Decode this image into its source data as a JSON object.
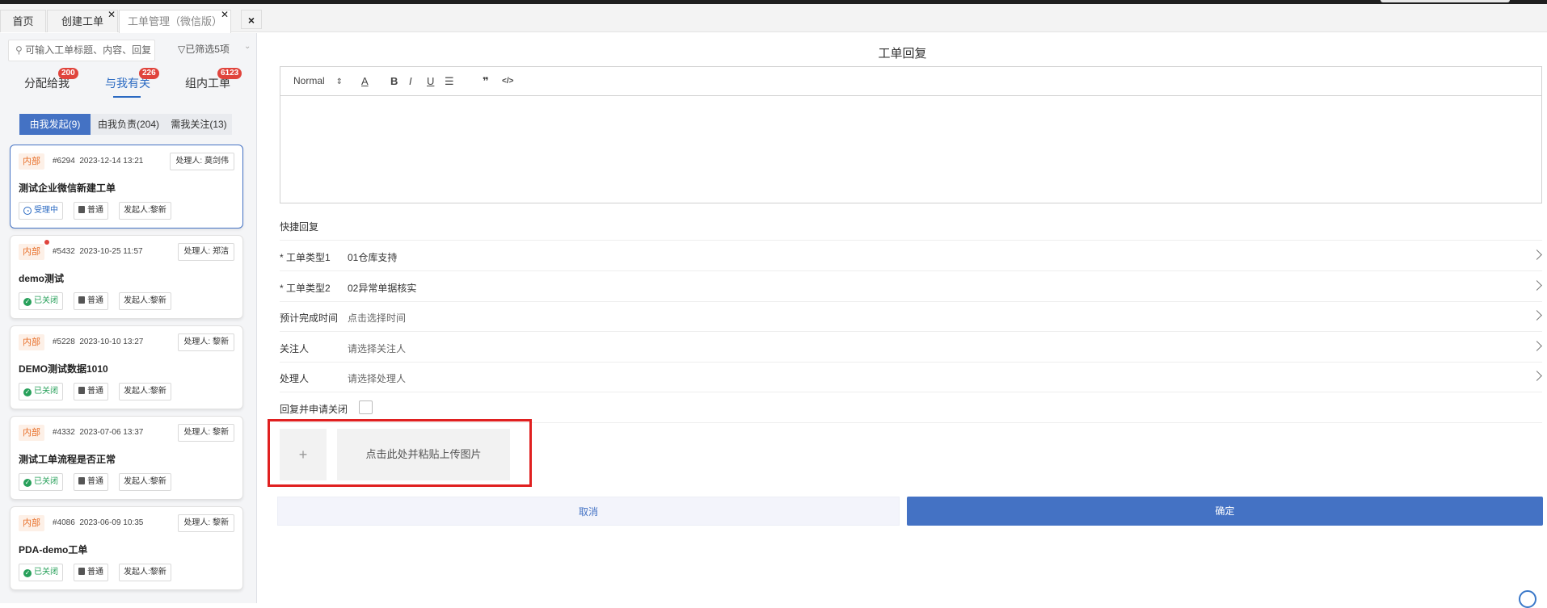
{
  "tabs": [
    {
      "label": "首页",
      "closable": false
    },
    {
      "label": "创建工单",
      "closable": true
    },
    {
      "label": "工单管理（微信版）",
      "closable": true,
      "active": true
    }
  ],
  "close_all_label": "×",
  "sidebar": {
    "search_placeholder": "可输入工单标题、内容、回复",
    "filter_label": "已筛选5项",
    "categories": [
      {
        "label": "分配给我",
        "badge": "200"
      },
      {
        "label": "与我有关",
        "badge": "226",
        "active": true
      },
      {
        "label": "组内工单",
        "badge": "6123"
      }
    ],
    "subtabs": [
      {
        "label": "由我发起(9)",
        "active": true
      },
      {
        "label": "由我负责(204)"
      },
      {
        "label": "需我关注(13)"
      }
    ],
    "cards": [
      {
        "tag": "内部",
        "number": "#6294",
        "date": "2023-12-14 13:21",
        "handler": "处理人: 莫剑伟",
        "title": "测试企业微信新建工单",
        "status": "受理中",
        "status_icon": "◔",
        "priority": "普通",
        "initiator": "发起人:黎新",
        "selected": true,
        "unread": false
      },
      {
        "tag": "内部",
        "number": "#5432",
        "date": "2023-10-25 11:57",
        "handler": "处理人: 郑洁",
        "title": "demo测试",
        "status": "已关闭",
        "status_icon": "✓",
        "priority": "普通",
        "initiator": "发起人:黎新",
        "selected": false,
        "unread": true
      },
      {
        "tag": "内部",
        "number": "#5228",
        "date": "2023-10-10 13:27",
        "handler": "处理人: 黎新",
        "title": "DEMO测试数据1010",
        "status": "已关闭",
        "status_icon": "✓",
        "priority": "普通",
        "initiator": "发起人:黎新",
        "selected": false,
        "unread": false
      },
      {
        "tag": "内部",
        "number": "#4332",
        "date": "2023-07-06 13:37",
        "handler": "处理人: 黎新",
        "title": "测试工单流程是否正常",
        "status": "已关闭",
        "status_icon": "✓",
        "priority": "普通",
        "initiator": "发起人:黎新",
        "selected": false,
        "unread": false
      },
      {
        "tag": "内部",
        "number": "#4086",
        "date": "2023-06-09 10:35",
        "handler": "处理人: 黎新",
        "title": "PDA-demo工单",
        "status": "已关闭",
        "status_icon": "✓",
        "priority": "普通",
        "initiator": "发起人:黎新",
        "selected": false,
        "unread": false
      }
    ]
  },
  "main": {
    "title": "工单回复",
    "editor_toolbar": {
      "format": "Normal",
      "bold": "B",
      "italic": "I",
      "underline": "U",
      "quote": "❞",
      "code": "</>"
    },
    "quick_reply_label": "快捷回复",
    "fields": [
      {
        "label": "* 工单类型1",
        "value": "01仓库支持",
        "placeholder": false
      },
      {
        "label": "* 工单类型2",
        "value": "02异常单据核实",
        "placeholder": false
      },
      {
        "label": "预计完成时间",
        "value": "点击选择时间",
        "placeholder": true
      },
      {
        "label": "关注人",
        "value": "请选择关注人",
        "placeholder": true
      },
      {
        "label": "处理人",
        "value": "请选择处理人",
        "placeholder": true
      }
    ],
    "close_request_label": "回复并申请关闭",
    "upload_plus": "+",
    "upload_paste_label": "点击此处并粘贴上传图片",
    "cancel_label": "取消",
    "confirm_label": "确定"
  },
  "colors": {
    "accent": "#4472c4",
    "badge": "#e0443c",
    "highlight": "#e02020",
    "closed": "#27a05a",
    "internal": "#e8702a"
  }
}
